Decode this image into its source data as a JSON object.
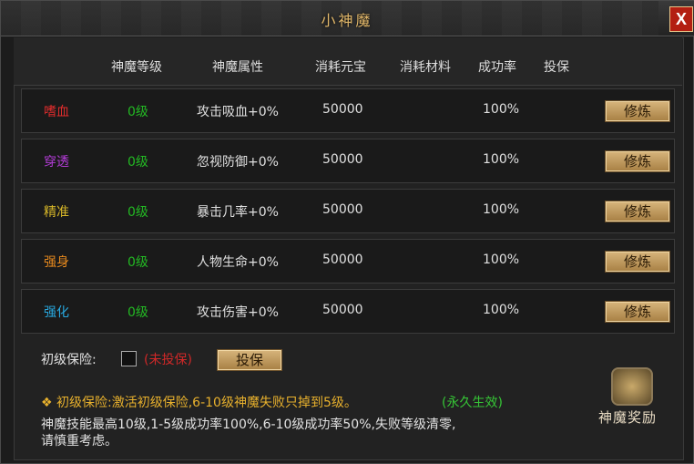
{
  "window": {
    "title": "小神魔",
    "close_label": "X"
  },
  "columns": [
    "神魔等级",
    "神魔属性",
    "消耗元宝",
    "消耗材料",
    "成功率",
    "投保"
  ],
  "rows": [
    {
      "name": "嗜血",
      "name_color": "#e02c2c",
      "level": "0级",
      "attr": "攻击吸血+0%",
      "cost": "50000",
      "material": "",
      "rate": "100%",
      "button": "修炼"
    },
    {
      "name": "穿透",
      "name_color": "#b23cd6",
      "level": "0级",
      "attr": "忽视防御+0%",
      "cost": "50000",
      "material": "",
      "rate": "100%",
      "button": "修炼"
    },
    {
      "name": "精准",
      "name_color": "#d8b828",
      "level": "0级",
      "attr": "暴击几率+0%",
      "cost": "50000",
      "material": "",
      "rate": "100%",
      "button": "修炼"
    },
    {
      "name": "强身",
      "name_color": "#e88a1e",
      "level": "0级",
      "attr": "人物生命+0%",
      "cost": "50000",
      "material": "",
      "rate": "100%",
      "button": "修炼"
    },
    {
      "name": "强化",
      "name_color": "#28a9e0",
      "level": "0级",
      "attr": "攻击伤害+0%",
      "cost": "50000",
      "material": "",
      "rate": "100%",
      "button": "修炼"
    }
  ],
  "insurance": {
    "label": "初级保险:",
    "status": "(未投保)",
    "button": "投保"
  },
  "notes": {
    "line1_prefix": "❖ 初级保险:激活初级保险,6-10级神魔失败只掉到5级。",
    "line1_suffix": "(永久生效)",
    "line2": "神魔技能最高10级,1-5级成功率100%,6-10级成功率50%,失败等级清零,",
    "line3": "请慎重考虑。"
  },
  "reward": {
    "label": "神魔奖励",
    "icon": "treasure-chest-icon"
  }
}
